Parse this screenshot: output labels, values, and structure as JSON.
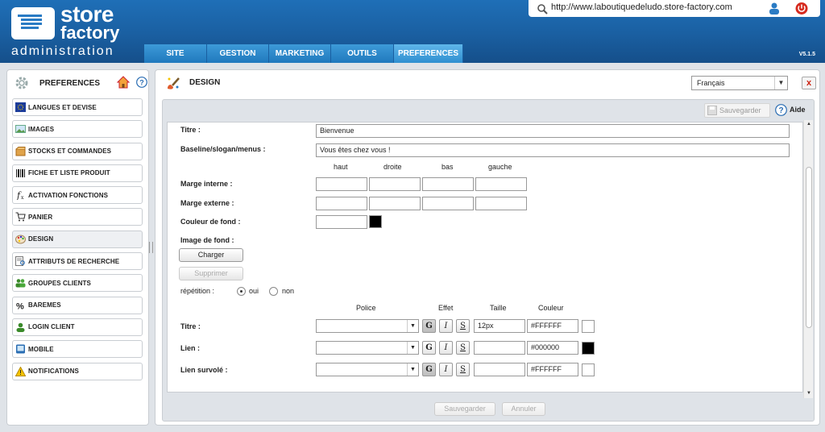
{
  "brand": {
    "line1": "store",
    "line2": "factory",
    "line3": "administration"
  },
  "nav": {
    "tabs": [
      "SITE",
      "GESTION",
      "MARKETING",
      "OUTILS",
      "PREFERENCES"
    ],
    "active": "PREFERENCES"
  },
  "header": {
    "url": "http://www.laboutiquedeludo.store-factory.com",
    "version": "V5.1.5"
  },
  "sidebar": {
    "title": "PREFERENCES",
    "items": [
      {
        "label": "LANGUES ET DEVISE",
        "icon": "flag-eu-icon"
      },
      {
        "label": "IMAGES",
        "icon": "image-icon"
      },
      {
        "label": "STOCKS ET COMMANDES",
        "icon": "box-icon"
      },
      {
        "label": "FICHE ET LISTE PRODUIT",
        "icon": "barcode-icon"
      },
      {
        "label": "ACTIVATION FONCTIONS",
        "icon": "function-icon"
      },
      {
        "label": "PANIER",
        "icon": "cart-icon"
      },
      {
        "label": "DESIGN",
        "icon": "palette-icon"
      },
      {
        "label": "ATTRIBUTS DE RECHERCHE",
        "icon": "search-attributes-icon"
      },
      {
        "label": "GROUPES CLIENTS",
        "icon": "users-icon"
      },
      {
        "label": "BAREMES",
        "icon": "percent-icon"
      },
      {
        "label": "LOGIN CLIENT",
        "icon": "user-icon"
      },
      {
        "label": "MOBILE",
        "icon": "mobile-icon"
      },
      {
        "label": "NOTIFICATIONS",
        "icon": "warning-icon"
      }
    ],
    "active": "DESIGN"
  },
  "main": {
    "title": "DESIGN",
    "language": "Français",
    "close": "x",
    "toolbar": {
      "save_label": "Sauvegarder",
      "help_label": "Aide"
    },
    "form": {
      "titre_label": "Titre :",
      "titre_value": "Bienvenue",
      "baseline_label": "Baseline/slogan/menus :",
      "baseline_value": "Vous êtes chez vous !",
      "col_haut": "haut",
      "col_droite": "droite",
      "col_bas": "bas",
      "col_gauche": "gauche",
      "marge_interne_label": "Marge interne :",
      "marge_externe_label": "Marge externe :",
      "couleur_fond_label": "Couleur de fond :",
      "couleur_fond_swatch": "#000000",
      "image_fond_label": "Image de fond :",
      "charger_label": "Charger",
      "supprimer_label": "Supprimer",
      "repetition_label": "répétition :",
      "oui_label": "oui",
      "non_label": "non",
      "repetition_value": "oui",
      "font_headers": {
        "police": "Police",
        "effet": "Effet",
        "taille": "Taille",
        "couleur": "Couleur"
      },
      "font_rows": [
        {
          "label": "Titre :",
          "size": "12px",
          "color": "#FFFFFF",
          "bold_active": true
        },
        {
          "label": "Lien :",
          "size": "",
          "color": "#000000",
          "bold_active": false
        },
        {
          "label": "Lien survolé :",
          "size": "",
          "color": "#FFFFFF",
          "bold_active": true
        }
      ],
      "effect_glyphs": {
        "bold": "G",
        "italic": "I",
        "strike": "S"
      }
    },
    "footer": {
      "save_label": "Sauvegarder",
      "cancel_label": "Annuler"
    }
  }
}
